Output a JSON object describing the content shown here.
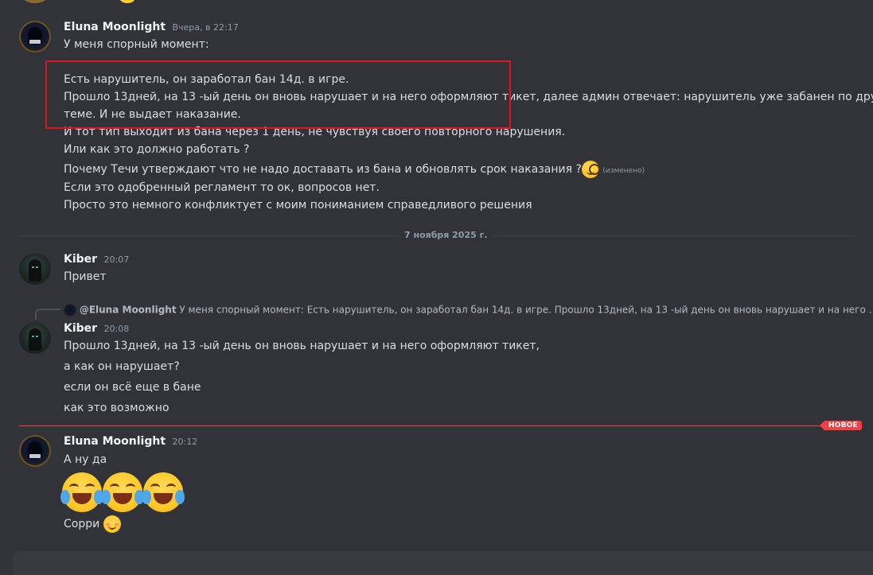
{
  "date_divider": "7 ноября 2025 г.",
  "new_badge": "НОВОЕ",
  "messages": {
    "m1": {
      "author": "Eluna Moonlight",
      "timestamp": "Вчера, в 22:17",
      "lines": [
        "У меня спорный момент:",
        "Есть  нарушитель,  он заработал бан 14д. в игре.",
        "Прошло 13дней, на 13 -ый день он вновь нарушает и на него оформляют тикет, далее админ отвечает: нарушитель уже забанен по другой",
        "теме. И не выдает наказание.",
        "И тот тип выходит из бана через 1 день, не чувствуя   своего повторного нарушения.",
        "Или как это должно работать ?",
        "Почему Течи утверждают что не надо доставать из бана и обновлять срок наказания ?",
        "Если это одобренный регламент то ок, вопросов нет.",
        "Просто это немного конфликтует с моим пониманием справедливого решения"
      ],
      "edited": "(изменено)"
    },
    "m2": {
      "author": "Kiber",
      "timestamp": "20:07",
      "text": "Привет"
    },
    "m3": {
      "reply_author": "@Eluna Moonlight",
      "reply_text": "У меня спорный момент:   Есть  нарушитель,  он заработал бан 14д. в игре.  Прошло 13дней, на 13 -ый день он вновь нарушает и на него …",
      "author": "Kiber",
      "timestamp": "20:08",
      "lines": [
        "Прошло 13дней, на 13 -ый день он вновь нарушает и на него оформляют тикет,",
        "а как он нарушает?",
        "если он всё еще в бане",
        "как это возможно"
      ]
    },
    "m4": {
      "author": "Eluna Moonlight",
      "timestamp": "20:12",
      "text": "А ну да",
      "text2": "Сорри"
    }
  },
  "icons": {
    "monocle_emoji": "face-with-monocle-emoji",
    "joy_emoji": "face-with-tears-of-joy-emoji",
    "blush_emoji": "smiling-face-emoji"
  },
  "colors": {
    "background": "#323339",
    "highlight_box": "#e0141e",
    "new_marker": "#f23f43"
  }
}
